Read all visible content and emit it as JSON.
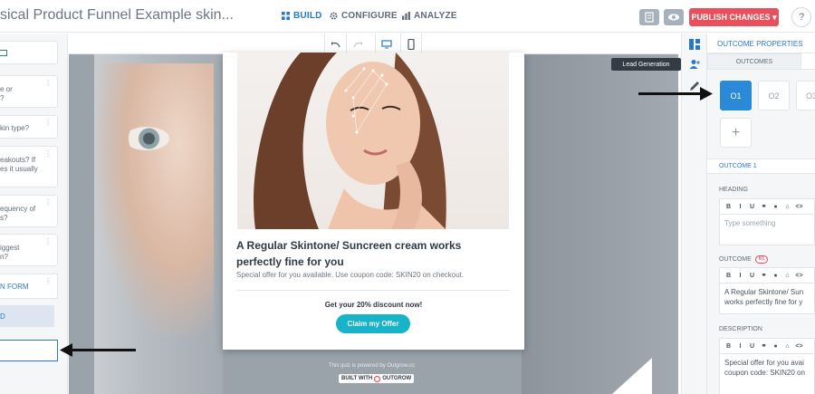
{
  "topbar": {
    "title": "sical Product Funnel Example skin...",
    "tabs": [
      {
        "label": "BUILD",
        "active": true,
        "icon": "grid-icon"
      },
      {
        "label": "CONFIGURE",
        "active": false,
        "icon": "gear-icon"
      },
      {
        "label": "ANALYZE",
        "active": false,
        "icon": "bar-chart-icon"
      }
    ],
    "publish_label": "PUBLISH CHANGES ▾",
    "help_label": "?"
  },
  "left_panel": {
    "questions": [
      {
        "lines": [
          ""
        ]
      },
      {
        "lines": [
          "e or",
          "?"
        ]
      },
      {
        "lines": [
          "kin type?"
        ]
      },
      {
        "lines": [
          "eakouts? If",
          "es it usually"
        ]
      },
      {
        "lines": [
          "equency of",
          "s?"
        ]
      },
      {
        "lines": [
          "iggest",
          "n?"
        ]
      }
    ],
    "lead_form_label": "N FORM",
    "add_label": "D"
  },
  "canvas": {
    "toolbar": [
      "undo-icon",
      "redo-icon",
      "desktop-icon",
      "mobile-icon"
    ],
    "card": {
      "headline": "A Regular Skintone/ Suncreen cream works perfectly fine for you",
      "offer_text": "Special offer for you available. Use coupon code: SKIN20 on checkout.",
      "discount_text": "Get your 20% discount now!",
      "cta_label": "Claim my Offer"
    },
    "powered_text": "This quiz is powered by Outgrow.co",
    "built_with": "BUILT WITH",
    "brand": "OUTGROW"
  },
  "right_panel": {
    "tooltip": "Lead Generation",
    "header": "OUTCOME PROPERTIES",
    "subtab": "OUTCOMES",
    "outcomes": [
      "O1",
      "O2",
      "O3"
    ],
    "add_outcome": "+",
    "outcome_title": "OUTCOME 1",
    "heading_label": "HEADING",
    "heading_placeholder": "Type something",
    "outcome_label": "OUTCOME",
    "outcome_badge": "61",
    "outcome_text_1": "A Regular Skintone/ Sun",
    "outcome_text_2": "works perfectly fine for y",
    "description_label": "DESCRIPTION",
    "description_text_1": "Special offer for you avai",
    "description_text_2": "coupon code: SKIN20 on",
    "editor_tools": [
      "B",
      "I",
      "U",
      "⚭",
      "●",
      "⌂",
      "<>"
    ]
  },
  "colors": {
    "accent": "#2a79c9",
    "publish": "#e8505b",
    "cta": "#16b3c9"
  }
}
